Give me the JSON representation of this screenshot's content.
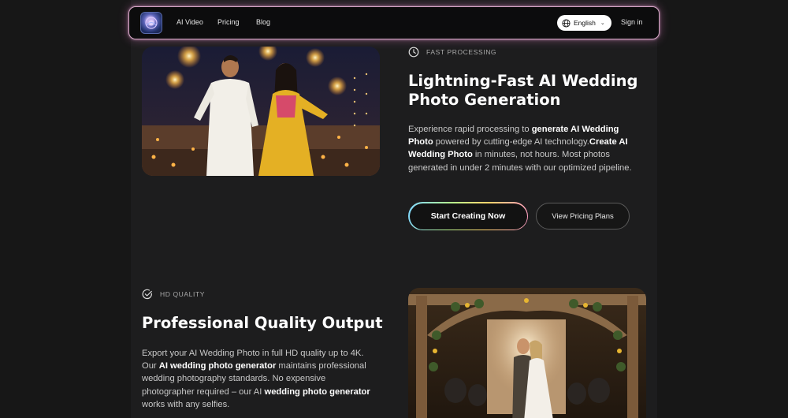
{
  "nav": {
    "logo_icon": "app-logo-icon",
    "links": [
      "AI Video",
      "Pricing",
      "Blog"
    ],
    "language": "English",
    "signin": "Sign in"
  },
  "feature_fast": {
    "tag": "FAST PROCESSING",
    "icon": "clock-icon",
    "title": "Lightning-Fast AI Wedding Photo Generation",
    "body": [
      {
        "t": "Experience rapid processing to ",
        "b": false
      },
      {
        "t": "generate AI Wedding Photo",
        "b": true
      },
      {
        "t": " powered by cutting-edge AI technology.",
        "b": false
      },
      {
        "t": "Create AI Wedding Photo",
        "b": true
      },
      {
        "t": " in minutes, not hours. Most photos generated in under 2 minutes with our optimized pipeline.",
        "b": false
      }
    ],
    "primary_button": "Start Creating Now",
    "secondary_button": "View Pricing Plans"
  },
  "feature_hd": {
    "tag": "HD QUALITY",
    "icon": "check-circle-icon",
    "title": "Professional Quality Output",
    "body": [
      {
        "t": "Export your AI Wedding Photo in full HD quality up to 4K. Our ",
        "b": false
      },
      {
        "t": "AI wedding photo generator",
        "b": true
      },
      {
        "t": " maintains professional wedding photography standards. No expensive photographer required – our AI ",
        "b": false
      },
      {
        "t": "wedding photo generator",
        "b": true
      },
      {
        "t": " works with any selfies.",
        "b": false
      }
    ]
  },
  "colors": {
    "background": "#171717",
    "nav_glow": "#d8a8c8",
    "button_gradient": [
      "#7fd6ff",
      "#b6f28d",
      "#ffd36b",
      "#ff9ec7"
    ]
  }
}
